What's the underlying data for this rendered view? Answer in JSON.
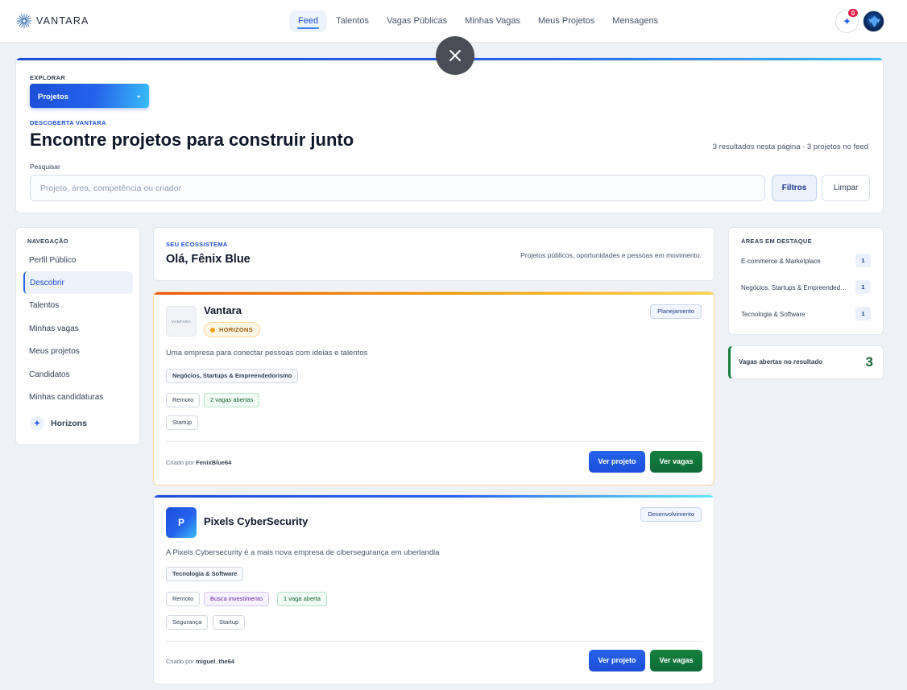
{
  "brand": {
    "name": "VANTARA"
  },
  "nav": {
    "items": [
      {
        "label": "Feed",
        "active": true
      },
      {
        "label": "Talentos",
        "active": false
      },
      {
        "label": "Vagas Públicas",
        "active": false
      },
      {
        "label": "Minhas Vagas",
        "active": false
      },
      {
        "label": "Meus Projetos",
        "active": false
      },
      {
        "label": "Mensagens",
        "active": false
      }
    ],
    "notification_count": "0"
  },
  "hero": {
    "explore_label": "EXPLORAR",
    "select_value": "Projetos",
    "kicker": "DESCOBERTA VANTARA",
    "title": "Encontre projetos para construir junto",
    "results": "3 resultados nesta página · 3 projetos no feed",
    "search_label": "Pesquisar",
    "search_placeholder": "Projeto, área, competência ou criador",
    "filters_label": "Filtros",
    "clear_label": "Limpar"
  },
  "sidebar": {
    "heading": "NAVEGAÇÃO",
    "items": [
      {
        "label": "Perfil Público"
      },
      {
        "label": "Descobrir"
      },
      {
        "label": "Talentos"
      },
      {
        "label": "Minhas vagas"
      },
      {
        "label": "Meus projetos"
      },
      {
        "label": "Candidatos"
      },
      {
        "label": "Minhas candidaturas"
      }
    ],
    "horizons_label": "Horizons"
  },
  "ecosystem": {
    "kicker": "SEU ECOSSISTEMA",
    "greeting": "Olá, Fênix Blue",
    "description": "Projetos públicos, oportunidades e pessoas em movimento."
  },
  "projects": [
    {
      "name": "Vantara",
      "logo_text": "VANTARA",
      "badge": "HORIZONS",
      "stage": "Planejamento",
      "description": "Uma empresa para conectar pessoas com ideias e talentos",
      "area": "Negócios, Startups & Empreendedorismo",
      "tags_row1": [
        "Remoto",
        "2 vagas abertas"
      ],
      "tags_row2": [
        "Startup"
      ],
      "creator_prefix": "Criado por",
      "creator": "FenixBlue64",
      "btn_project": "Ver projeto",
      "btn_jobs": "Ver vagas"
    },
    {
      "name": "Pixels CyberSecurity",
      "logo_letter": "P",
      "stage": "Desenvolvimento",
      "description": "A Pixels Cybersecurity é a mais nova empresa de cibersegurança em uberlandia",
      "area": "Tecnologia & Software",
      "tags_row1": [
        "Remoto",
        "Busca investimento",
        "1 vaga aberta"
      ],
      "tags_row2": [
        "Segurança",
        "Startup"
      ],
      "creator_prefix": "Criado por",
      "creator": "miguel_the64",
      "btn_project": "Ver projeto",
      "btn_jobs": "Ver vagas"
    }
  ],
  "areas": {
    "heading": "ÁREAS EM DESTAQUE",
    "items": [
      {
        "label": "E-commerce & Marketplace",
        "count": "1"
      },
      {
        "label": "Negócios, Startups & Empreendedorismo",
        "count": "1"
      },
      {
        "label": "Tecnologia & Software",
        "count": "1"
      }
    ]
  },
  "open_jobs": {
    "label": "Vagas abertas no resultado",
    "count": "3"
  },
  "colors": {
    "primary": "#2563eb",
    "success": "#15803d",
    "accent_orange": "#f59e0b"
  }
}
